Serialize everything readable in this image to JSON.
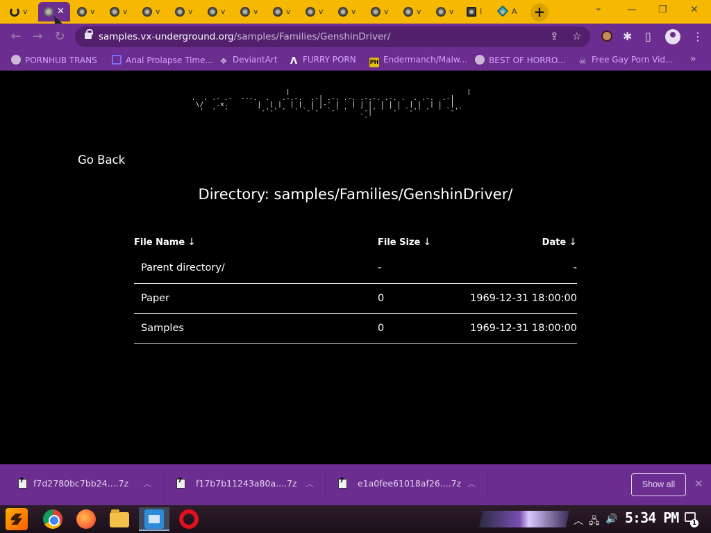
{
  "browser": {
    "tabs": [
      {
        "label": "v",
        "kind": "first"
      },
      {
        "label": "",
        "kind": "active"
      },
      {
        "label": "v",
        "kind": "site"
      },
      {
        "label": "v",
        "kind": "site"
      },
      {
        "label": "v",
        "kind": "site"
      },
      {
        "label": "v",
        "kind": "site"
      },
      {
        "label": "v",
        "kind": "site"
      },
      {
        "label": "v",
        "kind": "site"
      },
      {
        "label": "v",
        "kind": "site"
      },
      {
        "label": "v",
        "kind": "site"
      },
      {
        "label": "v",
        "kind": "site"
      },
      {
        "label": "v",
        "kind": "site"
      },
      {
        "label": "v",
        "kind": "site"
      },
      {
        "label": "v",
        "kind": "site"
      },
      {
        "label": "I",
        "kind": "cube"
      },
      {
        "label": "A",
        "kind": "gem"
      }
    ],
    "new_tab_glyph": "+",
    "close_tab_glyph": "✕",
    "window_controls": {
      "dropdown": "⌄",
      "minimize": "—",
      "maximize": "❐",
      "close": "✕"
    },
    "url": {
      "host": "samples.vx-underground.org",
      "path": "/samples/Families/GenshinDriver/"
    },
    "bookmarks": [
      {
        "label": "PORNHUB TRANS",
        "icon": "globe-icon"
      },
      {
        "label": "Anal Prolapse Time...",
        "icon": "square-icon"
      },
      {
        "label": "DeviantArt",
        "icon": "deviantart-icon"
      },
      {
        "label": "FURRY PORN",
        "icon": "a-logo-icon"
      },
      {
        "label": "Endermanch/Malw...",
        "icon": "ph-logo-icon"
      },
      {
        "label": "BEST OF HORRO...",
        "icon": "globe-icon"
      },
      {
        "label": "Free Gay Porn Vid...",
        "icon": "skull-icon"
      }
    ],
    "bookmark_logo_ph": "PH",
    "accent": "#6b2d8f",
    "tab_strip_color": "#f6b800"
  },
  "page": {
    "ascii_logo": "                        |                                           |\n .  . .- .-  ---.  .   .-.-.  .-| .-. .-. .-.-. .-. .  . .-.  .-|\n  \\/   .x.       |  | |  | |  | |-' |   | | |  | | |  | |  | |  |\n   '  '  '       `-'-' '  ' `-'-` `-' '   `-|' ' `-' `-'' '  ' `-'`\n                                          `-'",
    "go_back": "Go Back",
    "directory_label": "Directory: samples/Families/GenshinDriver/",
    "columns": {
      "name": "File Name",
      "size": "File Size",
      "date": "Date",
      "sort_arrow": "↓"
    },
    "rows": [
      {
        "name": "Parent directory/",
        "size": "-",
        "date": "-"
      },
      {
        "name": "Paper",
        "size": "0",
        "date": "1969-12-31 18:00:00"
      },
      {
        "name": "Samples",
        "size": "0",
        "date": "1969-12-31 18:00:00"
      }
    ]
  },
  "downloads": {
    "items": [
      {
        "name": "f7d2780bc7bb24....7z"
      },
      {
        "name": "f17b7b11243a80a....7z"
      },
      {
        "name": "e1a0fee61018af26....7z"
      }
    ],
    "chevron": "︿",
    "show_all": "Show all",
    "close": "✕"
  },
  "taskbar": {
    "clock": "5:34 PM",
    "notification_count": "1"
  }
}
